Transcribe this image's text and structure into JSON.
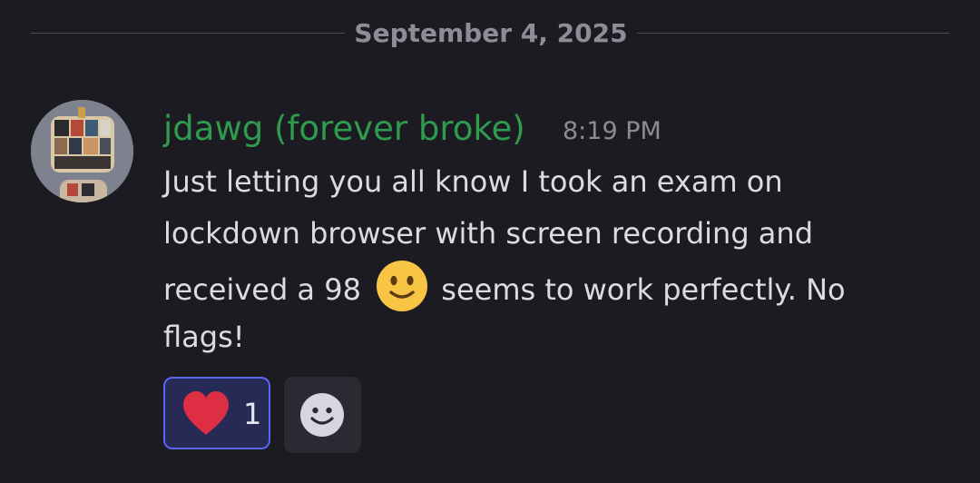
{
  "date_divider": {
    "label": "September 4, 2025"
  },
  "message": {
    "author": "jdawg (forever broke)",
    "timestamp": "8:19 PM",
    "lines": {
      "l1": "Just letting you all know I took an exam on",
      "l2": "lockdown browser with screen recording and",
      "l3_before": "received a 98",
      "l3_after": "seems to work perfectly. No",
      "l4": "flags!"
    },
    "inline_emoji": "slightly-smiling-face-icon"
  },
  "reactions": [
    {
      "emoji": "heart-icon",
      "count": "1",
      "selected": true
    }
  ],
  "add_reaction_icon": "add-reaction-smiley-icon",
  "colors": {
    "background": "#1c1b22",
    "username": "#2f9b4e",
    "text": "#dbdce2",
    "muted": "#8b8c96",
    "reaction_border": "#5865f2",
    "reaction_bg": "#262a55"
  }
}
